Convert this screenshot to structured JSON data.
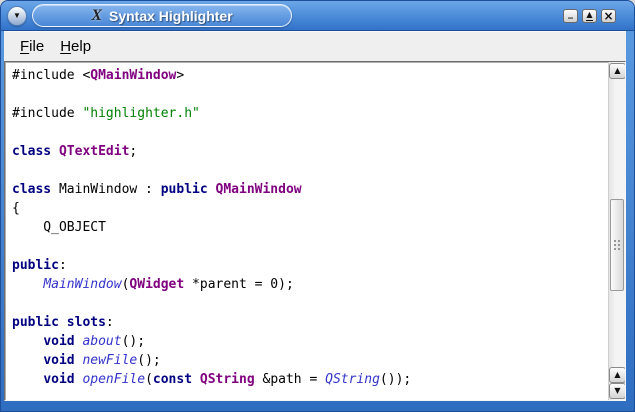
{
  "window": {
    "title": "Syntax Highlighter",
    "app_icon_glyph": "X",
    "menu_button_glyph": "▼",
    "controls": {
      "minimize_glyph": "_",
      "maximize_glyph": "▲",
      "close_glyph": "×"
    }
  },
  "menubar": {
    "items": [
      {
        "label": "File",
        "mnemonic": "F"
      },
      {
        "label": "Help",
        "mnemonic": "H"
      }
    ]
  },
  "editor": {
    "language": "cpp",
    "lines": [
      [
        [
          "plain",
          "#include <"
        ],
        [
          "qtclass",
          "QMainWindow"
        ],
        [
          "plain",
          ">"
        ]
      ],
      [],
      [
        [
          "plain",
          "#include "
        ],
        [
          "quote",
          "\"highlighter.h\""
        ]
      ],
      [],
      [
        [
          "keyword",
          "class"
        ],
        [
          "plain",
          " "
        ],
        [
          "qtclass",
          "QTextEdit"
        ],
        [
          "plain",
          ";"
        ]
      ],
      [],
      [
        [
          "keyword",
          "class"
        ],
        [
          "plain",
          " MainWindow : "
        ],
        [
          "keyword",
          "public"
        ],
        [
          "plain",
          " "
        ],
        [
          "qtclass",
          "QMainWindow"
        ]
      ],
      [
        [
          "plain",
          "{"
        ]
      ],
      [
        [
          "plain",
          "    Q_OBJECT"
        ]
      ],
      [],
      [
        [
          "keyword",
          "public"
        ],
        [
          "plain",
          ":"
        ]
      ],
      [
        [
          "plain",
          "    "
        ],
        [
          "func",
          "MainWindow"
        ],
        [
          "plain",
          "("
        ],
        [
          "qtclass",
          "QWidget"
        ],
        [
          "plain",
          " *parent = 0);"
        ]
      ],
      [],
      [
        [
          "keyword",
          "public slots"
        ],
        [
          "plain",
          ":"
        ]
      ],
      [
        [
          "plain",
          "    "
        ],
        [
          "keyword",
          "void"
        ],
        [
          "plain",
          " "
        ],
        [
          "func",
          "about"
        ],
        [
          "plain",
          "();"
        ]
      ],
      [
        [
          "plain",
          "    "
        ],
        [
          "keyword",
          "void"
        ],
        [
          "plain",
          " "
        ],
        [
          "func",
          "newFile"
        ],
        [
          "plain",
          "();"
        ]
      ],
      [
        [
          "plain",
          "    "
        ],
        [
          "keyword",
          "void"
        ],
        [
          "plain",
          " "
        ],
        [
          "func",
          "openFile"
        ],
        [
          "plain",
          "("
        ],
        [
          "keyword",
          "const"
        ],
        [
          "plain",
          " "
        ],
        [
          "qtclass",
          "QString"
        ],
        [
          "plain",
          " &path = "
        ],
        [
          "func",
          "QString"
        ],
        [
          "plain",
          "());"
        ]
      ]
    ]
  },
  "scrollbar": {
    "orientation": "vertical",
    "up_glyph": "▲",
    "down_glyph": "▼"
  },
  "colors": {
    "frame_top": "#5c9ce2",
    "frame_bottom": "#2e6dc0",
    "titlebar_line": "#1c4e9a",
    "pill_top": "#86b6ee",
    "pill_bottom": "#4886d6",
    "menubar_bg": "#efefef",
    "editor_bg": "#ffffff",
    "tok_plain": "#000000",
    "tok_keyword": "#000080",
    "tok_qtclass": "#800080",
    "tok_quote": "#008000",
    "tok_func": "#3333cc"
  }
}
